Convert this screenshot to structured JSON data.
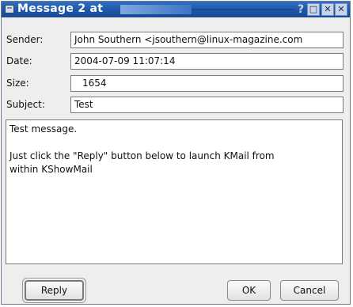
{
  "window": {
    "title": "Message 2 at",
    "help_glyph": "?",
    "maximize_glyph": "□",
    "close_glyph": "✕"
  },
  "headers": {
    "sender_label": "Sender:",
    "sender_value": "John Southern <jsouthern@linux-magazine.com",
    "date_label": "Date:",
    "date_value": "2004-07-09 11:07:14",
    "size_label": "Size:",
    "size_value": "1654",
    "subject_label": "Subject:",
    "subject_value": "Test"
  },
  "message": {
    "lines": [
      "Test message.",
      "",
      "Just click the \"Reply\" button below to launch KMail from",
      "within KShowMail"
    ]
  },
  "buttons": {
    "reply_label": "Reply",
    "ok_label": "OK",
    "cancel_label": "Cancel"
  },
  "colors": {
    "titlebar": "#1f56a6",
    "dialog_background": "#eeeeee",
    "field_background": "#ffffff"
  }
}
